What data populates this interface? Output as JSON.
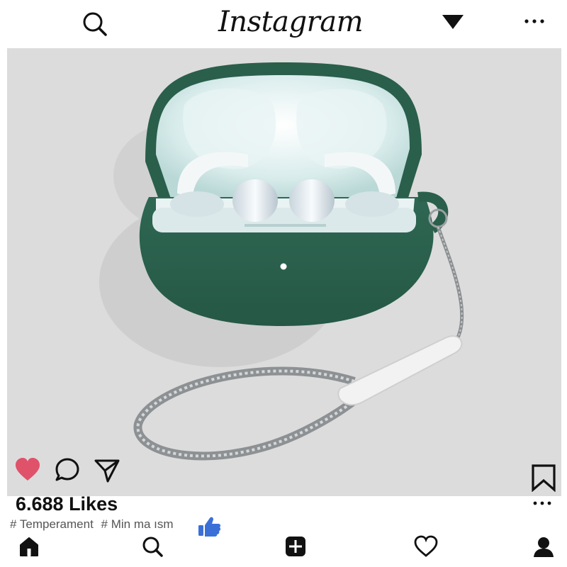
{
  "header": {
    "logo_text": "Instagram",
    "icons": [
      "search-icon",
      "dropdown-triangle-icon",
      "more-horizontal-icon"
    ]
  },
  "post": {
    "image_subject": "green earbuds charging case with lanyard",
    "likes_text": "6.688 Likes",
    "hashtags": [
      "# Temperament",
      "# Min ma ısm"
    ],
    "liked": true,
    "colors": {
      "like_red": "#e0526a",
      "case_green": "#2f6552",
      "thumb_blue": "#3b6fd8",
      "photo_bg": "#dcdcdc"
    }
  },
  "actions": {
    "icons": [
      "heart-icon",
      "comment-icon",
      "share-icon",
      "bookmark-icon"
    ]
  },
  "bottom_nav": {
    "items": [
      "home-icon",
      "search-icon",
      "add-post-icon",
      "activity-heart-icon",
      "profile-icon"
    ]
  }
}
